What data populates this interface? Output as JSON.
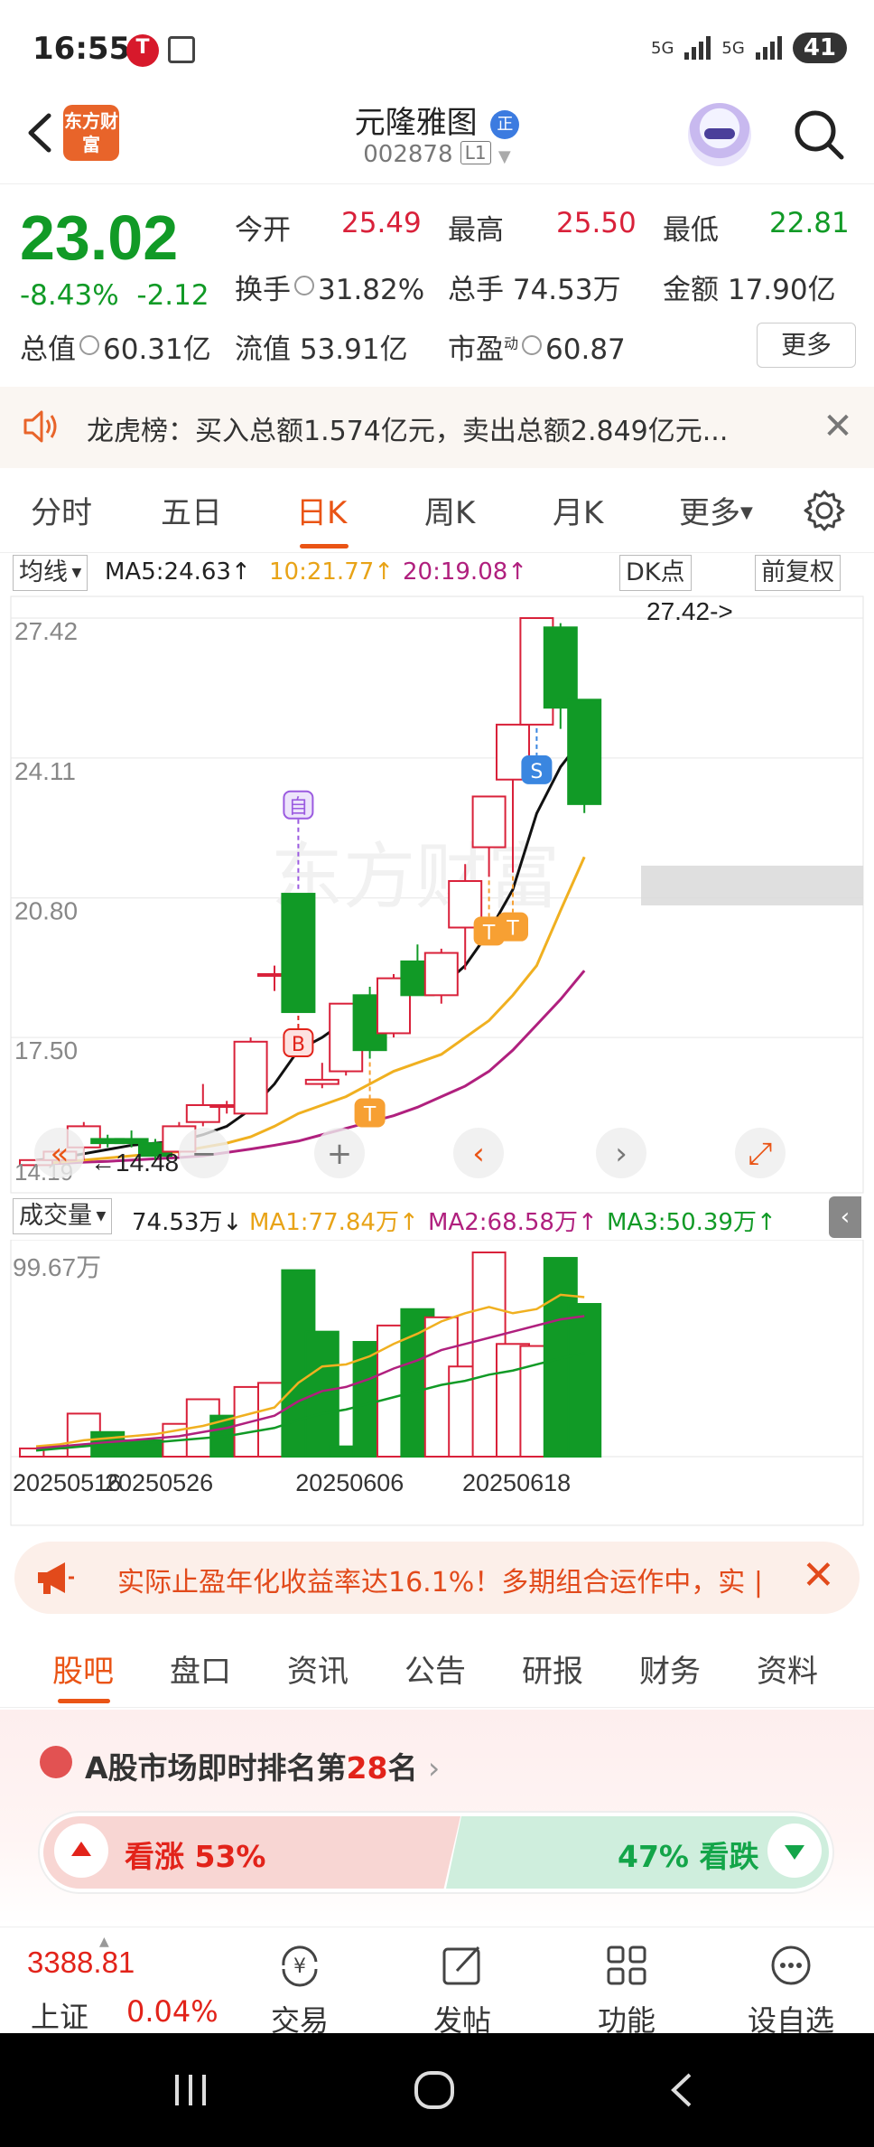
{
  "status_bar": {
    "time": "16:55",
    "battery": "41",
    "network1": "5G",
    "network2": "5G"
  },
  "header": {
    "logo_text": "东方财富",
    "stock_name": "元隆雅图",
    "stock_badge": "正",
    "stock_code": "002878",
    "code_badge": "L1"
  },
  "quote": {
    "price": "23.02",
    "change_pct": "-8.43%",
    "change": "-2.12",
    "open_label": "今开",
    "open": "25.49",
    "high_label": "最高",
    "high": "25.50",
    "low_label": "最低",
    "low": "22.81",
    "turnover_label": "换手",
    "turnover": "31.82%",
    "volume_label": "总手",
    "volume": "74.53万",
    "amount_label": "金额",
    "amount": "17.90亿",
    "mktcap_label": "总值",
    "mktcap": "60.31亿",
    "float_label": "流值",
    "float_cap": "53.91亿",
    "pe_label": "市盈",
    "pe_sup": "动",
    "pe": "60.87",
    "more_button": "更多"
  },
  "notice": {
    "text": "龙虎榜：买入总额1.574亿元，卖出总额2.849亿元..."
  },
  "chart_tabs": {
    "items": [
      "分时",
      "五日",
      "日K",
      "周K",
      "月K",
      "更多"
    ],
    "active": "日K"
  },
  "ma_row": {
    "selector": "均线",
    "ma5": "MA5:24.63",
    "ma10": "10:21.77",
    "ma20": "20:19.08",
    "dk_button": "DK点",
    "adjust_button": "前复权"
  },
  "colors": {
    "up": "#d9213a",
    "down": "#119a26",
    "ma5": "#111111",
    "ma10": "#f0b020",
    "ma20": "#b0207e",
    "accent": "#ea5415"
  },
  "chart_data": [
    {
      "type": "candlestick",
      "y_ticks": [
        "27.42",
        "24.11",
        "20.80",
        "17.50"
      ],
      "ylim": [
        14.19,
        27.42
      ],
      "max_label": "27.42->",
      "min_label": "14.48",
      "low_axis_label": "14.19",
      "candles": [
        {
          "o": 14.48,
          "h": 14.6,
          "l": 14.48,
          "c": 14.6
        },
        {
          "o": 14.6,
          "h": 14.8,
          "l": 14.5,
          "c": 14.8
        },
        {
          "o": 14.9,
          "h": 15.5,
          "l": 14.6,
          "c": 15.4
        },
        {
          "o": 15.1,
          "h": 15.2,
          "l": 14.9,
          "c": 15.0
        },
        {
          "o": 15.1,
          "h": 15.3,
          "l": 14.9,
          "c": 15.0
        },
        {
          "o": 15.0,
          "h": 15.1,
          "l": 14.6,
          "c": 14.7
        },
        {
          "o": 14.8,
          "h": 15.5,
          "l": 14.7,
          "c": 15.4
        },
        {
          "o": 15.5,
          "h": 16.4,
          "l": 15.4,
          "c": 15.9
        },
        {
          "o": 15.9,
          "h": 16.0,
          "l": 15.7,
          "c": 15.9
        },
        {
          "o": 15.7,
          "h": 17.5,
          "l": 15.7,
          "c": 17.4
        },
        {
          "o": 19.0,
          "h": 19.2,
          "l": 18.6,
          "c": 19.0
        },
        {
          "o": 20.9,
          "h": 20.9,
          "l": 18.1,
          "c": 18.1
        },
        {
          "o": 16.4,
          "h": 16.9,
          "l": 16.3,
          "c": 16.5
        },
        {
          "o": 16.7,
          "h": 18.3,
          "l": 16.6,
          "c": 18.3
        },
        {
          "o": 18.5,
          "h": 18.7,
          "l": 17.0,
          "c": 17.2
        },
        {
          "o": 17.6,
          "h": 19.0,
          "l": 17.5,
          "c": 18.9
        },
        {
          "o": 19.3,
          "h": 19.7,
          "l": 18.5,
          "c": 18.5
        },
        {
          "o": 18.5,
          "h": 19.6,
          "l": 18.3,
          "c": 19.5
        },
        {
          "o": 20.1,
          "h": 21.6,
          "l": 19.1,
          "c": 21.2
        },
        {
          "o": 22.0,
          "h": 23.2,
          "l": 21.3,
          "c": 23.2
        },
        {
          "o": 23.6,
          "h": 24.9,
          "l": 21.4,
          "c": 24.9
        },
        {
          "o": 24.9,
          "h": 27.42,
          "l": 24.9,
          "c": 27.42
        },
        {
          "o": 27.2,
          "h": 27.3,
          "l": 24.8,
          "c": 25.3
        },
        {
          "o": 25.49,
          "h": 25.5,
          "l": 22.81,
          "c": 23.02
        }
      ],
      "ma5": [
        14.6,
        14.65,
        14.75,
        14.85,
        14.95,
        15.0,
        15.05,
        15.2,
        15.4,
        15.8,
        16.4,
        17.2,
        17.5,
        17.9,
        18.3,
        18.7,
        18.7,
        18.7,
        19.2,
        20.0,
        21.0,
        22.8,
        23.9,
        24.63
      ],
      "ma10": [
        14.5,
        14.55,
        14.6,
        14.65,
        14.7,
        14.75,
        14.8,
        14.9,
        15.0,
        15.15,
        15.4,
        15.7,
        15.9,
        16.1,
        16.4,
        16.7,
        16.9,
        17.1,
        17.5,
        17.9,
        18.5,
        19.2,
        20.5,
        21.77
      ],
      "ma20": [
        14.5,
        14.52,
        14.55,
        14.57,
        14.6,
        14.63,
        14.66,
        14.7,
        14.78,
        14.86,
        14.95,
        15.05,
        15.2,
        15.35,
        15.5,
        15.65,
        15.85,
        16.1,
        16.35,
        16.7,
        17.2,
        17.8,
        18.4,
        19.08
      ],
      "markers": [
        {
          "index": 11,
          "text": "自",
          "kind": "purple"
        },
        {
          "index": 11,
          "text": "B",
          "kind": "red"
        },
        {
          "index": 14,
          "text": "T",
          "kind": "orange"
        },
        {
          "index": 19,
          "text": "T",
          "kind": "orange"
        },
        {
          "index": 20,
          "text": "T",
          "kind": "orange"
        },
        {
          "index": 21,
          "text": "S",
          "kind": "blue"
        }
      ]
    },
    {
      "type": "bar",
      "title": "成交量",
      "current": "74.53万",
      "ma1_label": "MA1:77.84万",
      "ma2_label": "MA2:68.58万",
      "ma3_label": "MA3:50.39万",
      "y_max_label": "99.67万",
      "ylim": [
        0,
        99.67
      ],
      "x_labels": [
        {
          "index": 0,
          "text": "20250516"
        },
        {
          "index": 5,
          "text": "20250526"
        },
        {
          "index": 13,
          "text": "20250606"
        },
        {
          "index": 20,
          "text": "20250618"
        }
      ],
      "values": [
        4,
        4,
        21,
        12,
        8,
        8,
        16,
        28,
        20,
        34,
        36,
        91,
        61,
        5,
        56,
        64,
        72,
        68,
        44,
        99.67,
        55,
        54,
        97,
        74.53
      ],
      "up": [
        true,
        true,
        true,
        false,
        false,
        false,
        true,
        true,
        false,
        true,
        true,
        false,
        false,
        false,
        false,
        true,
        false,
        true,
        true,
        true,
        true,
        true,
        false,
        false
      ],
      "ma1": [
        5,
        6,
        8,
        9,
        10,
        11,
        13,
        15,
        18,
        21,
        24,
        36,
        44,
        45,
        49,
        55,
        60,
        66,
        70,
        73,
        70,
        72,
        79,
        77.84
      ],
      "ma2": [
        4,
        5,
        6,
        7,
        8,
        9,
        10,
        12,
        14,
        17,
        20,
        27,
        32,
        34,
        38,
        43,
        47,
        52,
        55,
        58,
        61,
        64,
        67,
        68.58
      ],
      "ma3": [
        3,
        4,
        5,
        6,
        6,
        7,
        8,
        9,
        10,
        12,
        14,
        18,
        21,
        23,
        26,
        29,
        32,
        35,
        37,
        40,
        42,
        45,
        48,
        50.39
      ]
    }
  ],
  "ad": {
    "text": "实际止盈年化收益率达16.1%！多期组合运作中，实 |"
  },
  "bottom_tabs": {
    "items": [
      "股吧",
      "盘口",
      "资讯",
      "公告",
      "研报",
      "财务",
      "资料"
    ],
    "active": "股吧"
  },
  "rank": {
    "prefix": "A股市场即时排名第",
    "num": "28",
    "suffix": "名",
    "up_label": "看涨 53%",
    "down_label": "47% 看跌"
  },
  "bottom_nav": {
    "index_value": "3388.81",
    "index_name": "上证",
    "index_pct": "0.04%",
    "items": [
      "交易",
      "发帖",
      "功能",
      "设自选"
    ]
  }
}
